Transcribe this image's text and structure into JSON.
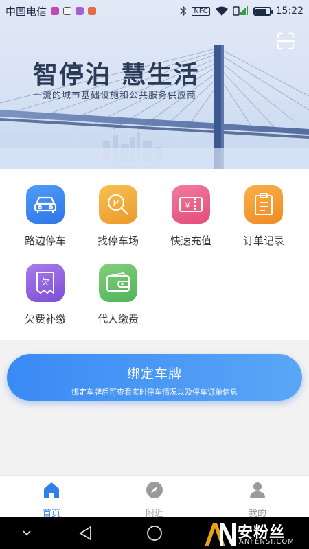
{
  "status_bar": {
    "carrier": "中国电信",
    "time": "15:22",
    "battery_level": 0.85,
    "icons": [
      "gallery-icon",
      "a-app-icon",
      "smiley-app-icon",
      "bag-app-icon",
      "bluetooth-icon",
      "nfc-icon",
      "wifi-icon",
      "signal-icon",
      "battery-icon"
    ],
    "nfc_label": "NFC"
  },
  "banner": {
    "title": "智停泊 慧生活",
    "subtitle": "一流的城市基础设施和公共服务供应商"
  },
  "grid": {
    "items": [
      {
        "label": "路边停车",
        "icon": "car-icon",
        "color_from": "#4f9cf7",
        "color_to": "#2e76e6"
      },
      {
        "label": "找停车场",
        "icon": "parking-search-icon",
        "color_from": "#f7c052",
        "color_to": "#eb9a2a"
      },
      {
        "label": "快速充值",
        "icon": "recharge-ticket-icon",
        "color_from": "#f27a9e",
        "color_to": "#e24d7a"
      },
      {
        "label": "订单记录",
        "icon": "order-clipboard-icon",
        "color_from": "#f9b04a",
        "color_to": "#ef8a22"
      },
      {
        "label": "欠费补缴",
        "icon": "arrears-receipt-icon",
        "color_from": "#a77bea",
        "color_to": "#7e4fd6"
      },
      {
        "label": "代人缴费",
        "icon": "wallet-icon",
        "color_from": "#83d07a",
        "color_to": "#4fb45a"
      }
    ]
  },
  "bind_card": {
    "title": "绑定车牌",
    "subtitle": "绑定车牌后可查看实时停车情况以及停车订单信息"
  },
  "tabbar": {
    "tabs": [
      {
        "label": "首页",
        "icon": "home-icon",
        "active": true
      },
      {
        "label": "附近",
        "icon": "compass-icon",
        "active": false
      },
      {
        "label": "我的",
        "icon": "user-icon",
        "active": false
      }
    ],
    "active_color": "#2f7fe8",
    "inactive_color": "#9a9a9a"
  },
  "watermark": {
    "cn": "安粉丝",
    "en": "ANFENSI.COM"
  }
}
